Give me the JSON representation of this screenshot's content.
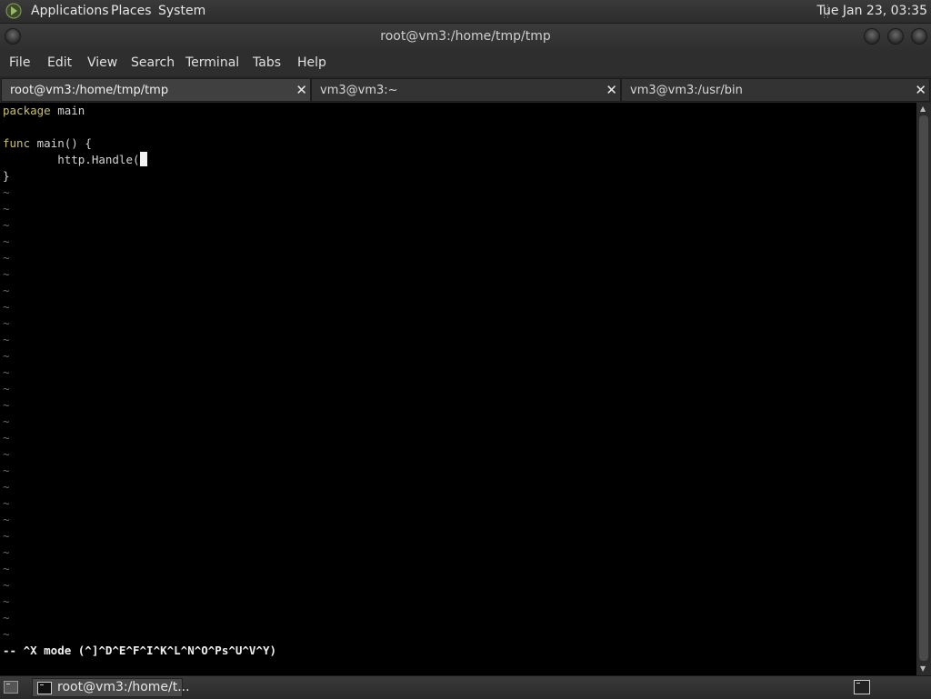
{
  "top_panel": {
    "menus": [
      "Applications",
      "Places",
      "System"
    ],
    "clock": "Tue Jan 23, 03:35"
  },
  "window": {
    "title": "root@vm3:/home/tmp/tmp"
  },
  "menubar": {
    "items": [
      "File",
      "Edit",
      "View",
      "Search",
      "Terminal",
      "Tabs",
      "Help"
    ]
  },
  "tabs": [
    {
      "label": "root@vm3:/home/tmp/tmp",
      "active": true
    },
    {
      "label": "vm3@vm3:~",
      "active": false
    },
    {
      "label": "vm3@vm3:/usr/bin",
      "active": false
    }
  ],
  "tab_close_glyph": "✕",
  "editor": {
    "line1_kw": "package",
    "line1_rest": " main",
    "line2": "",
    "line3_kw": "func",
    "line3_rest": " main() {",
    "line4": "        http.Handle(",
    "line5": "}",
    "tilde": "~",
    "status": "-- ^X mode (^]^D^E^F^I^K^L^N^O^Ps^U^V^Y)"
  },
  "bottom_panel": {
    "task_label": "root@vm3:/home/t..."
  },
  "icons": [
    "applications-icon",
    "window-menu-icon",
    "minimize-icon",
    "maximize-icon",
    "close-icon",
    "show-desktop-icon",
    "terminal-icon",
    "workspace-switcher-icon"
  ],
  "colors": {
    "keyword": "#c8c06a",
    "terminal_bg": "#000000",
    "tilde": "#6a6a6a"
  }
}
